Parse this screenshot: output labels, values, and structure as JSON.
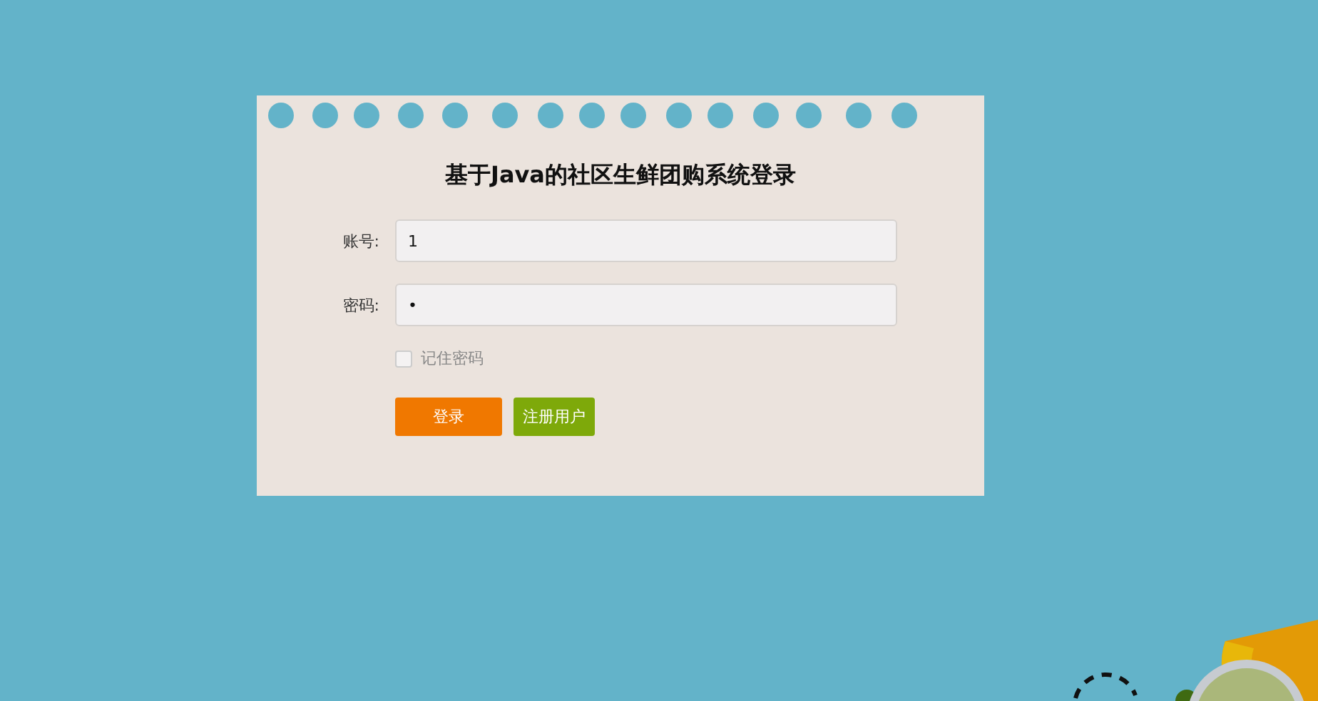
{
  "title": "基于Java的社区生鲜团购系统登录",
  "fields": [
    {
      "label": "账号:",
      "value": "1"
    },
    {
      "label": "密码:",
      "value": "•"
    }
  ],
  "remember": {
    "label": "记住密码",
    "checked": false
  },
  "buttons": [
    {
      "label": "登录",
      "kind": "primary"
    },
    {
      "label": "注册用户",
      "kind": "secondary"
    }
  ]
}
